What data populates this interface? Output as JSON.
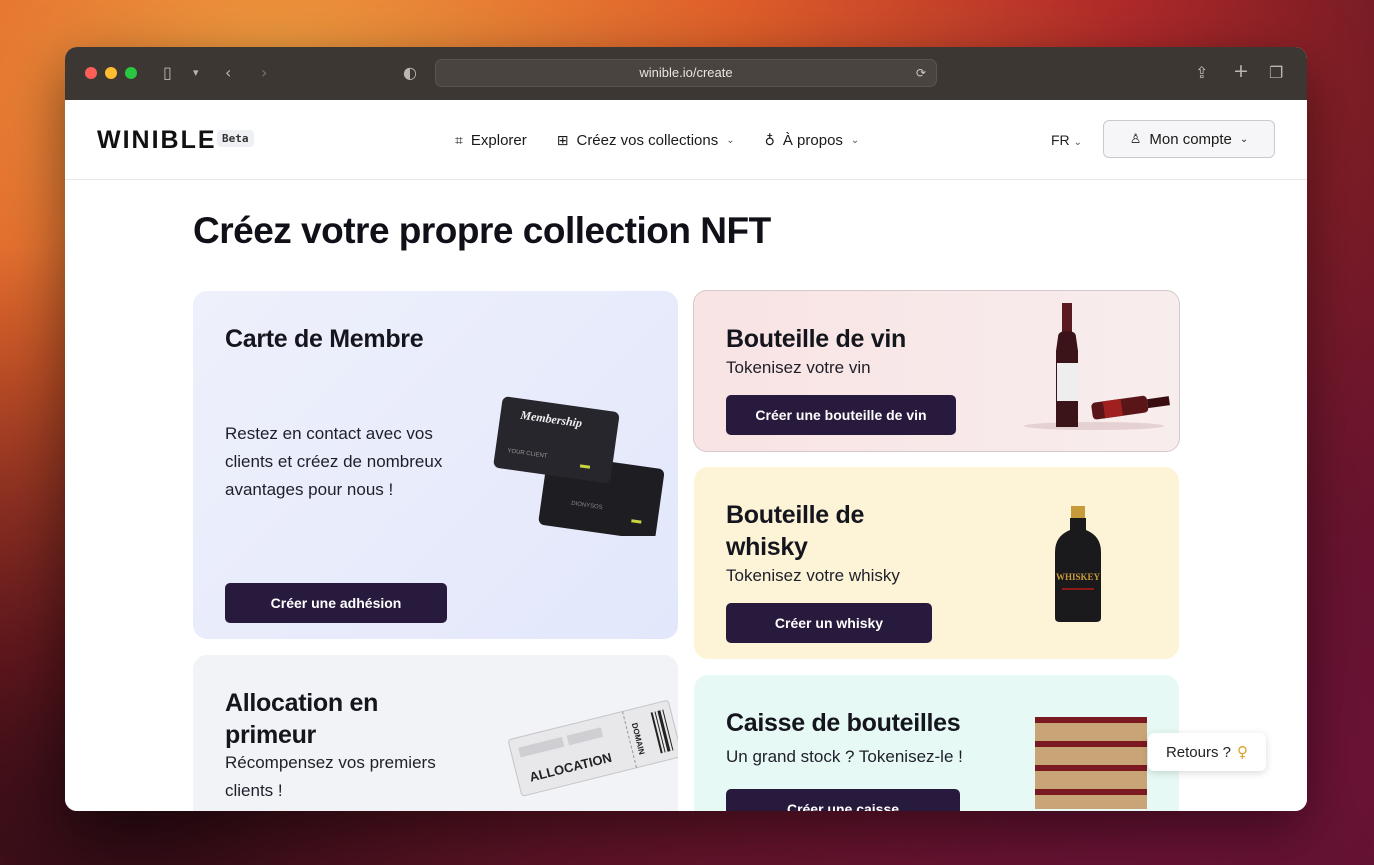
{
  "browser": {
    "url": "winible.io/create"
  },
  "nav": {
    "logo": "WINIBLE",
    "beta": "Beta",
    "items": [
      {
        "label": "Explorer"
      },
      {
        "label": "Créez vos collections"
      },
      {
        "label": "À propos"
      }
    ],
    "lang": "FR",
    "account": "Mon compte"
  },
  "page": {
    "title": "Créez votre propre collection NFT"
  },
  "cards": {
    "membre": {
      "title": "Carte de Membre",
      "desc": "Restez en contact avec vos clients et créez de nombreux avantages pour nous !",
      "button": "Créer une adhésion",
      "card_text_1": "Membership",
      "card_text_2": "YOUR CLIENT",
      "card_text_3": "DIONYSOS"
    },
    "vin": {
      "title": "Bouteille de vin",
      "sub": "Tokenisez votre vin",
      "button": "Créer une bouteille de vin"
    },
    "whisky": {
      "title": "Bouteille de whisky",
      "sub": "Tokenisez votre whisky",
      "button": "Créer un whisky",
      "label": "WHISKEY"
    },
    "alloc": {
      "title": "Allocation en primeur",
      "sub": "Récompensez vos premiers clients !",
      "ticket_big": "ALLOCATION",
      "ticket_side": "DOMAIN"
    },
    "caisse": {
      "title": "Caisse de bouteilles",
      "sub": "Un grand stock ? Tokenisez-le !",
      "button": "Créer une caisse"
    }
  },
  "feedback": {
    "label": "Retours ?"
  },
  "colors": {
    "button": "#281a3d",
    "membre_bg": "#e6eafb",
    "vin_bg": "#f9e5e6",
    "whisky_bg": "#fdf4d8",
    "caisse_bg": "#e6f9f4"
  }
}
